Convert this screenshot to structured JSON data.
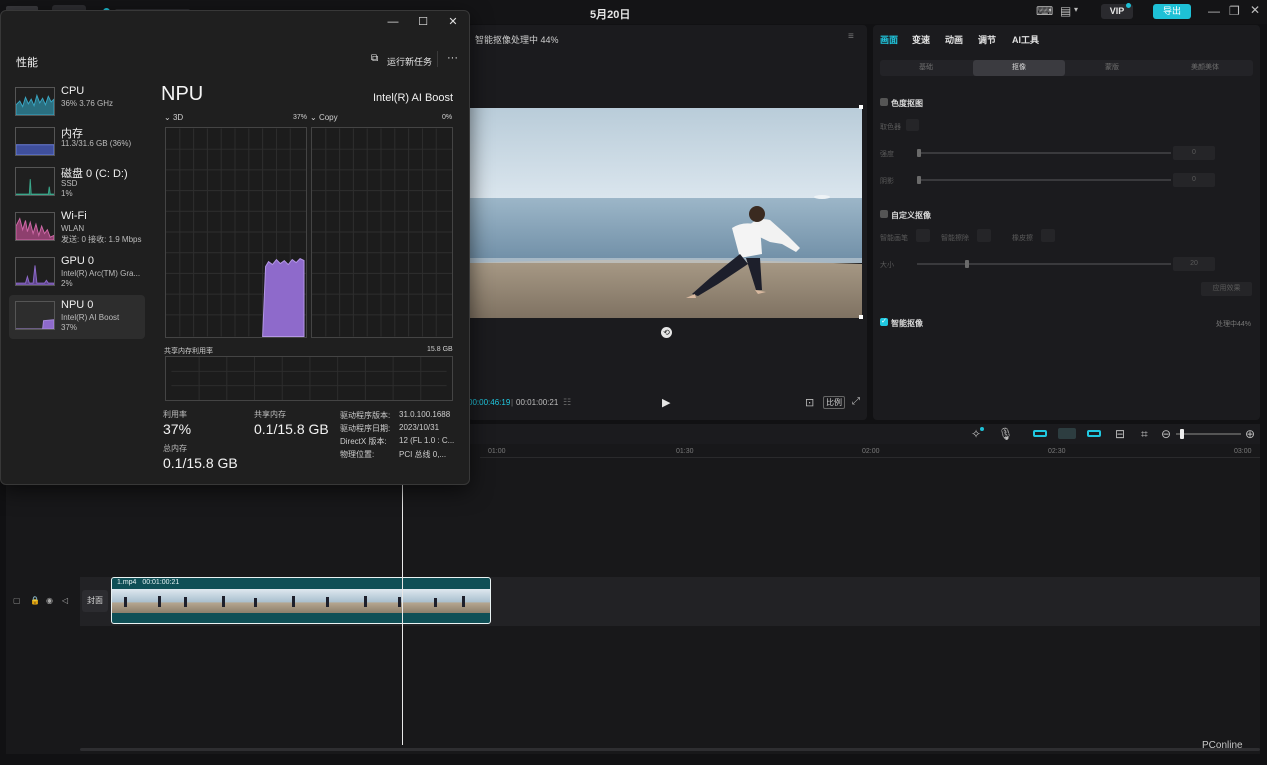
{
  "editor": {
    "date": "5月20日",
    "vip": "VIP",
    "export": "导出",
    "preview": {
      "title": "智能抠像处理中 44%",
      "time_current": "00:00:46:19",
      "time_total": "00:01:00:21",
      "ratio": "比例"
    },
    "right_panel": {
      "tabs": [
        "画面",
        "变速",
        "动画",
        "调节",
        "AI工具"
      ],
      "active_tab": "画面",
      "subtabs": [
        "基础",
        "抠像",
        "蒙版",
        "美颜美体"
      ],
      "active_subtab": "抠像",
      "chroma_key": {
        "title": "色度抠图",
        "picker": "取色器",
        "strength": "强度",
        "shadow": "阴影",
        "strength_value": "0",
        "shadow_value": "0"
      },
      "custom_key": {
        "title": "自定义抠像",
        "smart_brush": "智能画笔",
        "smart_eraser": "智能擦除",
        "eraser": "橡皮擦",
        "size": "大小",
        "size_value": "20",
        "apply": "应用效果"
      },
      "smart_key": {
        "title": "智能抠像",
        "status": "处理中44%"
      }
    },
    "timeline": {
      "ruler": [
        "01:00",
        "01:30",
        "02:00",
        "02:30",
        "03:00"
      ],
      "cover": "封面",
      "clip_name": "1.mp4",
      "clip_duration": "00:01:00:21"
    },
    "watermark": "PConline"
  },
  "task_manager": {
    "title": "性能",
    "run_new_task": "运行新任务",
    "more": "···",
    "sidebar": [
      {
        "name": "CPU",
        "line1": "36%  3.76 GHz",
        "line2": "",
        "color": "#3aa6c2"
      },
      {
        "name": "内存",
        "line1": "11.3/31.6 GB (36%)",
        "line2": "",
        "color": "#6a7fd8"
      },
      {
        "name": "磁盘 0 (C: D:)",
        "line1": "SSD",
        "line2": "1%",
        "color": "#3aa78a"
      },
      {
        "name": "Wi-Fi",
        "line1": "WLAN",
        "line2": "发送: 0 接收: 1.9 Mbps",
        "color": "#d06aa8"
      },
      {
        "name": "GPU 0",
        "line1": "Intel(R) Arc(TM) Gra...",
        "line2": "2%",
        "color": "#8e6acb"
      },
      {
        "name": "NPU 0",
        "line1": "Intel(R) AI Boost",
        "line2": "37%",
        "color": "#8e6acb"
      }
    ],
    "selected": "NPU 0",
    "detail": {
      "title": "NPU",
      "device": "Intel(R) AI Boost",
      "graph1_label": "3D",
      "graph1_pct": "37%",
      "graph2_label": "Copy",
      "graph2_pct": "0%",
      "shared_mem_label": "共享内存利用率",
      "shared_mem_max": "15.8 GB",
      "utilization_label": "利用率",
      "utilization": "37%",
      "shared_label": "共享内存",
      "shared": "0.1/15.8 GB",
      "total_label": "总内存",
      "total": "0.1/15.8 GB",
      "driver_version_label": "驱动程序版本:",
      "driver_version": "31.0.100.1688",
      "driver_date_label": "驱动程序日期:",
      "driver_date": "2023/10/31",
      "directx_label": "DirectX 版本:",
      "directx": "12 (FL 1.0 : C...",
      "location_label": "物理位置:",
      "location": "PCI 总线 0,..."
    }
  }
}
